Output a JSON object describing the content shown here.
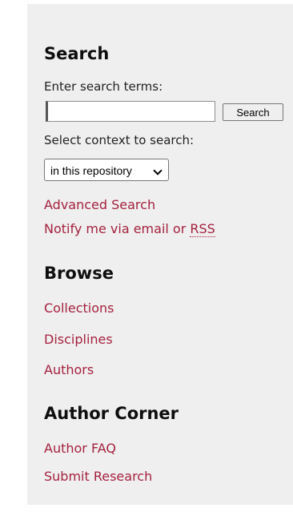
{
  "search": {
    "title": "Search",
    "terms_label": "Enter search terms:",
    "input_value": "",
    "button_label": "Search",
    "context_label": "Select context to search:",
    "context_selected": "in this repository",
    "advanced_link": "Advanced Search",
    "notify_text": "Notify me via email or ",
    "notify_rss": "RSS"
  },
  "browse": {
    "title": "Browse",
    "links": [
      "Collections",
      "Disciplines",
      "Authors"
    ]
  },
  "author_corner": {
    "title": "Author Corner",
    "links": [
      "Author FAQ",
      "Submit Research"
    ]
  },
  "colors": {
    "link": "#a5223f",
    "sidebar_background": "#efefef",
    "heading": "#0e0e0e"
  },
  "icons": {
    "select_arrow": "chevron-down-icon"
  }
}
